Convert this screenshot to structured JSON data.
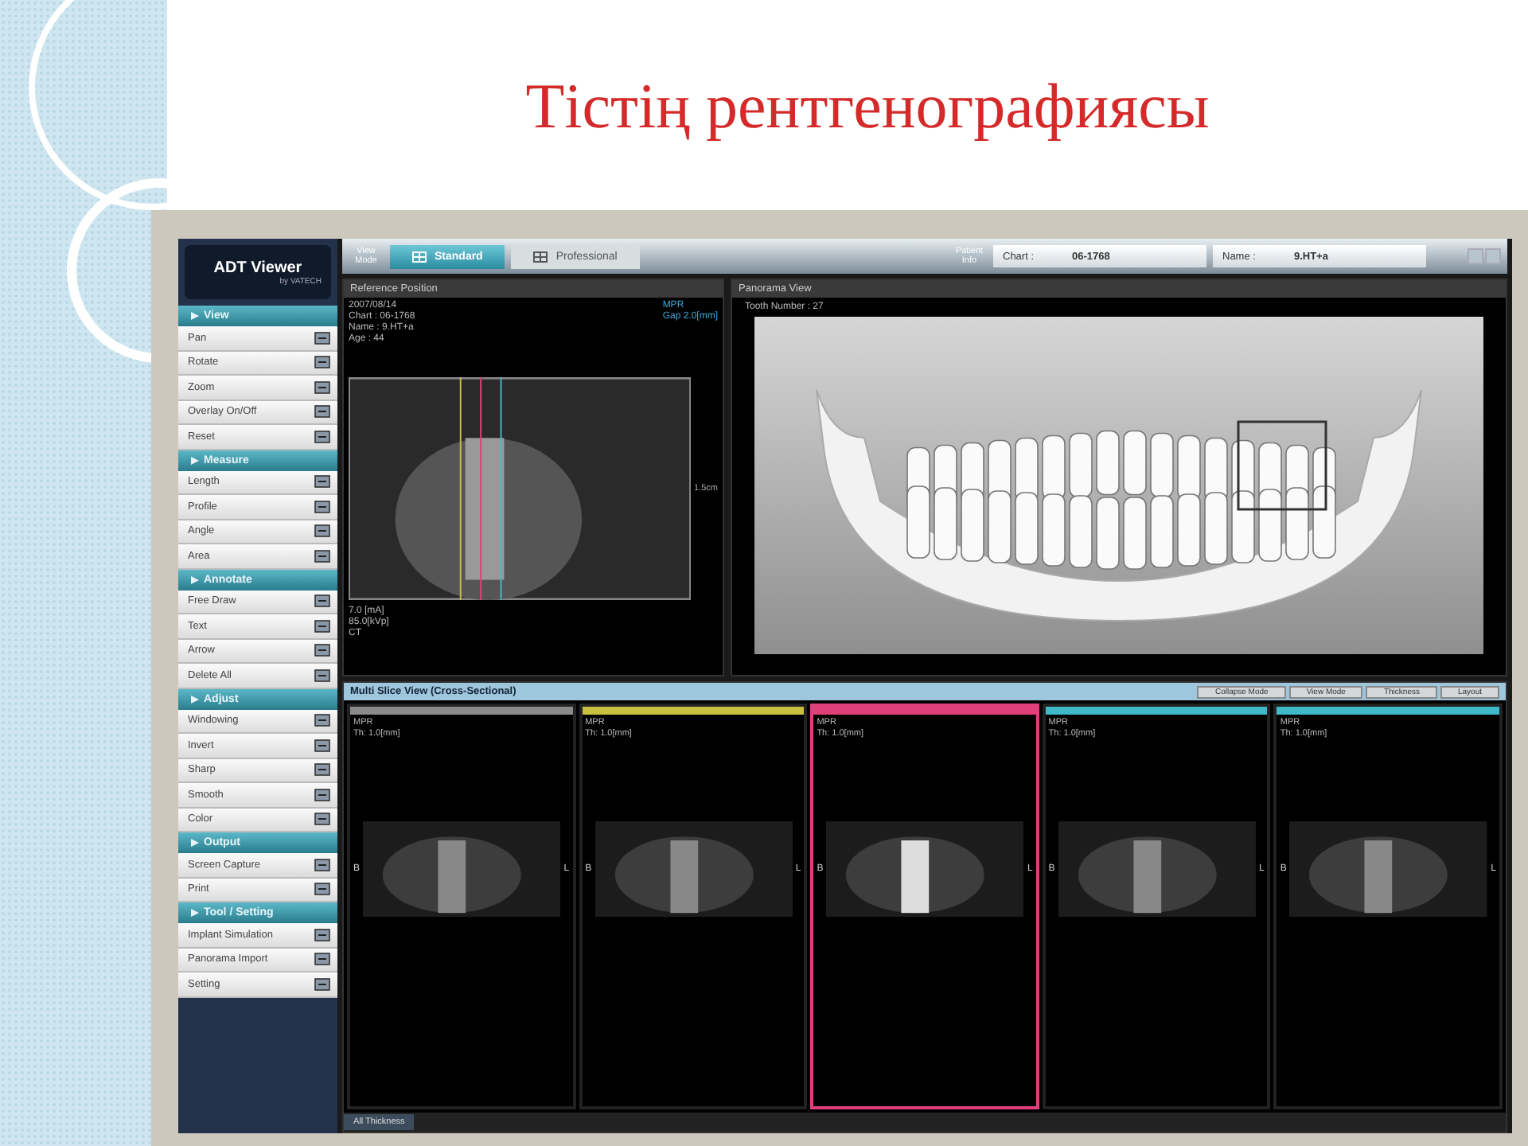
{
  "slide_title": "Тістің рентгенографиясы",
  "app": {
    "logo": "ADT Viewer",
    "logo_sub": "by VATECH",
    "sidebar": [
      {
        "title": "View",
        "items": [
          "Pan",
          "Rotate",
          "Zoom",
          "Overlay On/Off",
          "Reset"
        ]
      },
      {
        "title": "Measure",
        "items": [
          "Length",
          "Profile",
          "Angle",
          "Area"
        ]
      },
      {
        "title": "Annotate",
        "items": [
          "Free Draw",
          "Text",
          "Arrow",
          "Delete All"
        ]
      },
      {
        "title": "Adjust",
        "items": [
          "Windowing",
          "Invert",
          "Sharp",
          "Smooth",
          "Color"
        ]
      },
      {
        "title": "Output",
        "items": [
          "Screen Capture",
          "Print"
        ]
      },
      {
        "title": "Tool / Setting",
        "items": [
          "Implant Simulation",
          "Panorama Import",
          "Setting"
        ]
      }
    ],
    "view_mode_label": "View Mode",
    "tabs": [
      {
        "label": "Standard",
        "selected": true
      },
      {
        "label": "Professional",
        "selected": false
      }
    ],
    "patient_label": "Patient Info",
    "patient": [
      {
        "label": "Chart :",
        "value": "06-1768"
      },
      {
        "label": "Name :",
        "value": "9.HT+a"
      }
    ],
    "reference": {
      "title": "Reference Position",
      "info": [
        "2007/08/14",
        "Chart : 06-1768",
        "Name : 9.HT+a",
        "Age : 44"
      ],
      "mode": [
        "MPR",
        "Gap 2.0[mm]"
      ],
      "scale": "1.5cm",
      "exposure": [
        "7.0 [mA]",
        "85.0[kVp]",
        "CT"
      ]
    },
    "panorama": {
      "title": "Panorama View",
      "tooth": "Tooth Number : 27"
    },
    "multi_slice": {
      "title": "Multi Slice View (Cross-Sectional)",
      "buttons": [
        "Collapse Mode",
        "View Mode",
        "Thickness",
        "Layout"
      ],
      "slices": [
        {
          "mode": "MPR",
          "thickness": "Th: 1.0[mm]",
          "left": "B",
          "right": "L",
          "color": "#8a8a8a",
          "selected": false
        },
        {
          "mode": "MPR",
          "thickness": "Th: 1.0[mm]",
          "left": "B",
          "right": "L",
          "color": "#c8c040",
          "selected": false
        },
        {
          "mode": "MPR",
          "thickness": "Th: 1.0[mm]",
          "left": "B",
          "right": "L",
          "color": "#e0407a",
          "selected": true
        },
        {
          "mode": "MPR",
          "thickness": "Th: 1.0[mm]",
          "left": "B",
          "right": "L",
          "color": "#40b8c8",
          "selected": false
        },
        {
          "mode": "MPR",
          "thickness": "Th: 1.0[mm]",
          "left": "B",
          "right": "L",
          "color": "#40b8c8",
          "selected": false
        }
      ]
    },
    "bottom_tab": "All Thickness"
  }
}
